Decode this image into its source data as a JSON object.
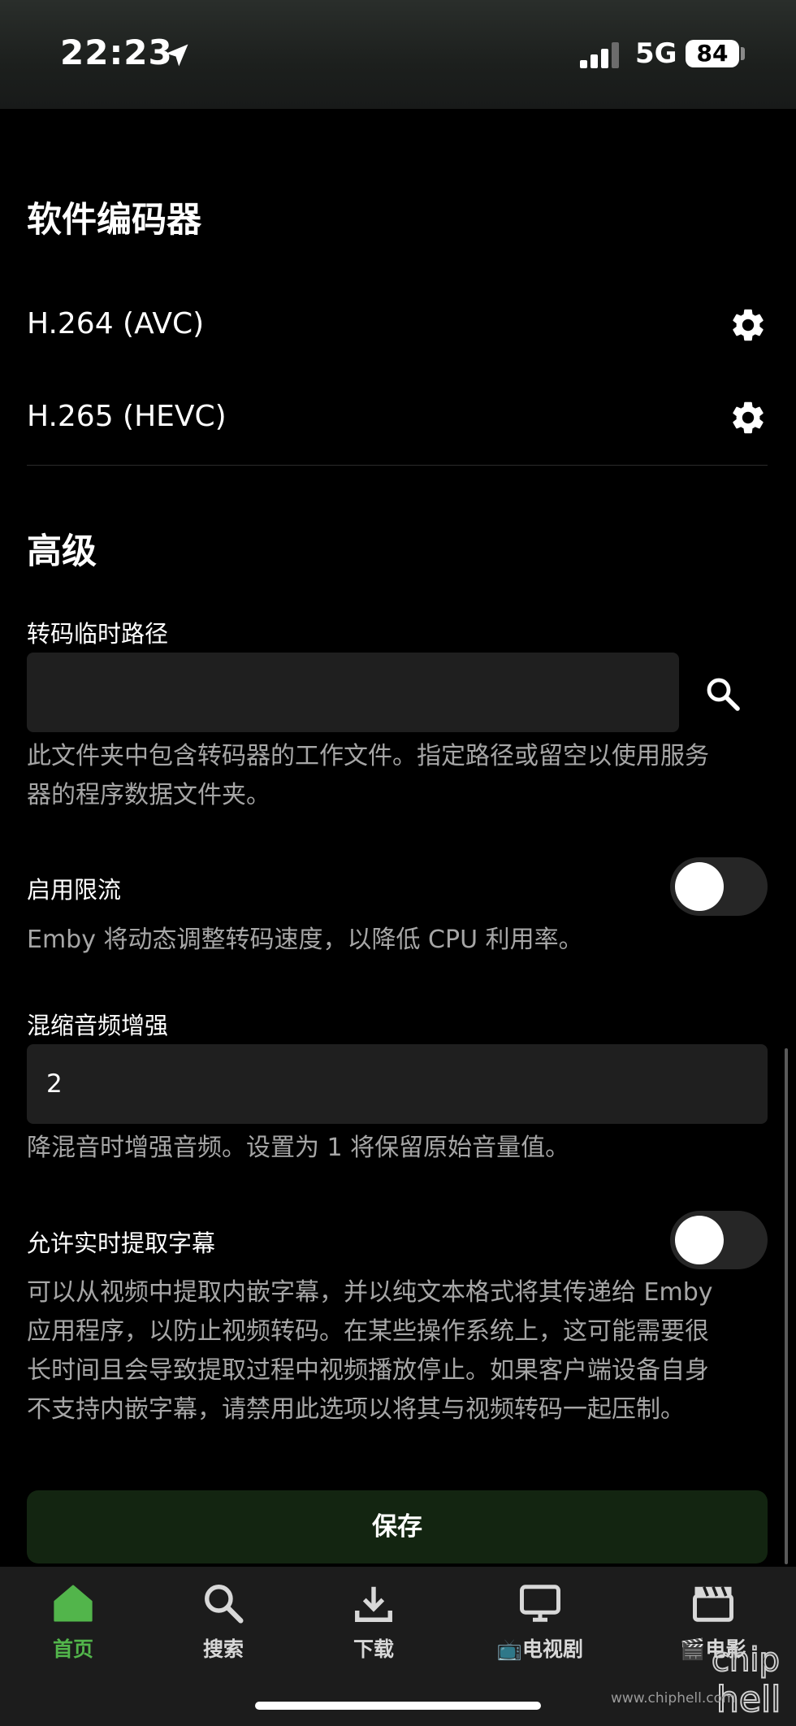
{
  "status_bar": {
    "time": "22:23",
    "network": "5G",
    "battery": "84"
  },
  "software_encoders": {
    "title": "软件编码器",
    "items": [
      {
        "label": "H.264 (AVC)"
      },
      {
        "label": "H.265 (HEVC)"
      }
    ]
  },
  "advanced": {
    "title": "高级",
    "temp_path": {
      "label": "转码临时路径",
      "value": "",
      "desc_line1": "此文件夹中包含转码器的工作文件。指定路径或留空以使用服务",
      "desc_line2": "器的程序数据文件夹。"
    },
    "throttling": {
      "label": "启用限流",
      "enabled": false,
      "desc": "Emby 将动态调整转码速度，以降低 CPU 利用率。"
    },
    "downmix": {
      "label": "混缩音频增强",
      "value": "2",
      "desc": "降混音时增强音频。设置为 1 将保留原始音量值。"
    },
    "subtitles": {
      "label": "允许实时提取字幕",
      "enabled": false,
      "desc_line1": "可以从视频中提取内嵌字幕，并以纯文本格式将其传递给 Emby",
      "desc_line2": "应用程序，以防止视频转码。在某些操作系统上，这可能需要很",
      "desc_line3": "长时间且会导致提取过程中视频播放停止。如果客户端设备自身",
      "desc_line4": "不支持内嵌字幕，请禁用此选项以将其与视频转码一起压制。"
    },
    "save_label": "保存"
  },
  "bottom_nav": {
    "items": [
      {
        "label": "首页",
        "icon": "home-icon",
        "active": true
      },
      {
        "label": "搜索",
        "icon": "search-icon",
        "active": false
      },
      {
        "label": "下载",
        "icon": "download-icon",
        "active": false
      },
      {
        "label": "📺电视剧",
        "icon": "tv-icon",
        "active": false
      },
      {
        "label": "🎬电影",
        "icon": "movie-icon",
        "active": false
      }
    ]
  },
  "watermark": {
    "text": "www.chiphell.com",
    "logo_text": "chip hell"
  },
  "colors": {
    "accent": "#52b54b",
    "background": "#000000",
    "input_bg": "#1f1f1f",
    "save_bg": "#132511"
  }
}
